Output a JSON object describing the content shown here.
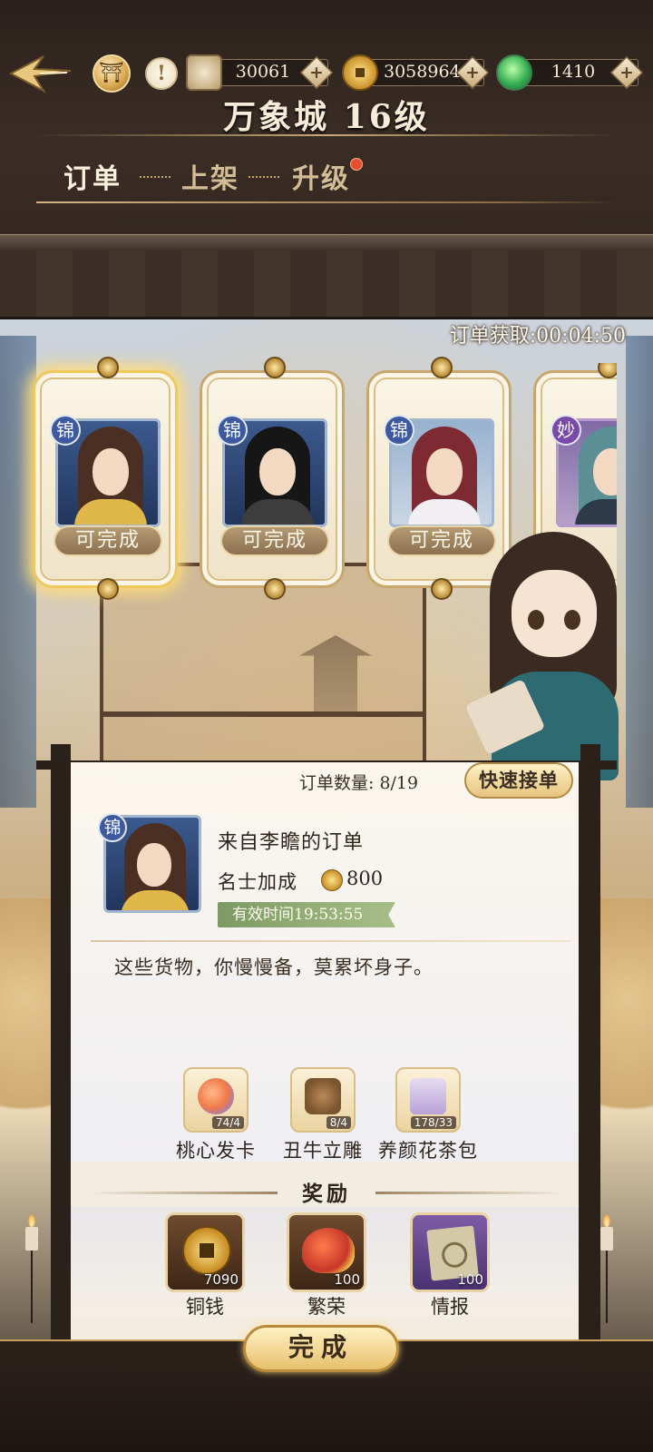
{
  "header": {
    "title": "万象城 16级",
    "resources": [
      {
        "name": "scroll",
        "value": "30061"
      },
      {
        "name": "copper-coin",
        "value": "3058964"
      },
      {
        "name": "jade",
        "value": "1410"
      }
    ],
    "info_glyph": "!"
  },
  "tabs": [
    {
      "label": "订单",
      "active": true
    },
    {
      "label": "上架",
      "active": false
    },
    {
      "label": "升级",
      "active": false,
      "badge": true
    }
  ],
  "timer": "订单获取:00:04:50",
  "cards": [
    {
      "tier": "锦",
      "status": "可完成",
      "selected": true
    },
    {
      "tier": "锦",
      "status": "可完成",
      "selected": false
    },
    {
      "tier": "锦",
      "status": "可完成",
      "selected": false
    },
    {
      "tier": "妙",
      "status": "",
      "selected": false
    }
  ],
  "order": {
    "count_label": "订单数量: 8/19",
    "quick_accept": "快速接单",
    "tier": "锦",
    "from": "来自李瞻的订单",
    "bonus_label": "名士加成",
    "bonus_value": "800",
    "validity": "有效时间19:53:55",
    "quote": "这些货物，你慢慢备，莫累坏身子。",
    "requirements": [
      {
        "name": "桃心发卡",
        "count": "74/4",
        "icon": "hairpin-icon"
      },
      {
        "name": "丑牛立雕",
        "count": "8/4",
        "icon": "ox-statue-icon"
      },
      {
        "name": "养颜花茶包",
        "count": "178/33",
        "icon": "tea-pack-icon"
      }
    ],
    "reward_title": "奖励",
    "rewards": [
      {
        "name": "铜钱",
        "count": "7090",
        "icon": "copper-coin-icon"
      },
      {
        "name": "繁荣",
        "count": "100",
        "icon": "prosperity-icon"
      },
      {
        "name": "情报",
        "count": "100",
        "icon": "intel-icon"
      }
    ],
    "complete": "完成"
  },
  "colors": {
    "accent_gold": "#e7c06c",
    "tier_blue": "#3d5aa0",
    "tier_purple": "#7a4aa8",
    "badge_red": "#e4502e"
  }
}
